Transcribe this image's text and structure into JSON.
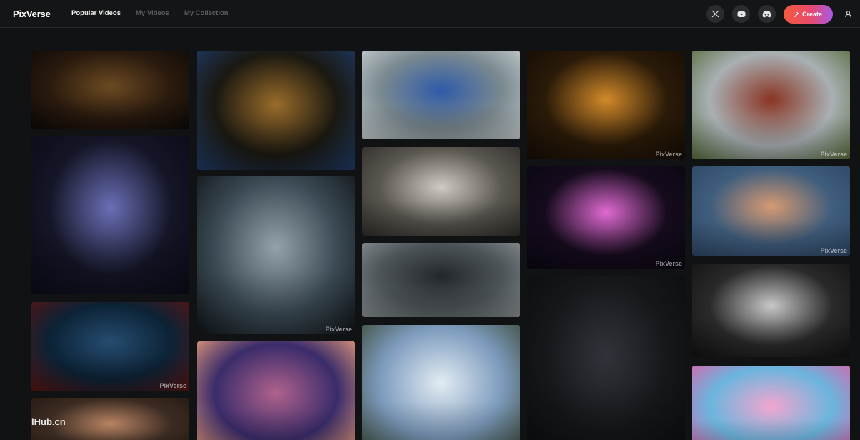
{
  "app": {
    "logo": "PixVerse"
  },
  "nav": {
    "items": [
      {
        "label": "Popular Videos",
        "active": true
      },
      {
        "label": "My Videos",
        "active": false
      },
      {
        "label": "My Collection",
        "active": false
      }
    ]
  },
  "actions": {
    "create_label": "Create",
    "icons": [
      "x-icon",
      "youtube-icon",
      "discord-icon",
      "user-icon"
    ]
  },
  "watermark": "PixVerse",
  "overlay_text": "lHub.cn",
  "cards": [
    {
      "name": "car-night-road",
      "colors": [
        "#2a1a0e",
        "#6b4a22",
        "#0c0907"
      ],
      "watermark": false
    },
    {
      "name": "jellyfish-blue",
      "colors": [
        "#141526",
        "#6a6fb6",
        "#0a0b17"
      ],
      "watermark": false
    },
    {
      "name": "sports-car-neon-city",
      "colors": [
        "#0c2235",
        "#254c70",
        "#581412"
      ],
      "watermark": true
    },
    {
      "name": "woman-portrait",
      "colors": [
        "#3b2b22",
        "#b88463",
        "#241812"
      ],
      "watermark": false
    },
    {
      "name": "fairy-butterfly",
      "colors": [
        "#1a1811",
        "#9a6c2a",
        "#1f3a66"
      ],
      "watermark": false
    },
    {
      "name": "woman-lake-mountains",
      "colors": [
        "#3b4a54",
        "#94a2ab",
        "#101418"
      ],
      "watermark": true
    },
    {
      "name": "purple-sunset-clouds",
      "colors": [
        "#3a2c6a",
        "#b0628c",
        "#f0a27a"
      ],
      "watermark": false
    },
    {
      "name": "bluebird-water",
      "colors": [
        "#7b8a90",
        "#2e5aa8",
        "#c9d0d2"
      ],
      "watermark": false
    },
    {
      "name": "perfume-bottle",
      "colors": [
        "#5a5650",
        "#cfcbc4",
        "#2e2c28"
      ],
      "watermark": false
    },
    {
      "name": "knight-horse-village",
      "colors": [
        "#4d5458",
        "#22272b",
        "#8a9094"
      ],
      "watermark": false
    },
    {
      "name": "snowy-mountains",
      "colors": [
        "#7d9bbd",
        "#e3ecf3",
        "#3c4a38"
      ],
      "watermark": false
    },
    {
      "name": "sunset-lake",
      "colors": [
        "#2a1a08",
        "#d28a2a",
        "#150c06"
      ],
      "watermark": true
    },
    {
      "name": "pink-jellyfish",
      "colors": [
        "#150b1c",
        "#e06ad3",
        "#0a0712"
      ],
      "watermark": true
    },
    {
      "name": "hooded-figure-forest",
      "colors": [
        "#15171a",
        "#30343a",
        "#0b0c0e"
      ],
      "watermark": false
    },
    {
      "name": "train-village",
      "colors": [
        "#a9b0b4",
        "#8a3422",
        "#566a3a"
      ],
      "watermark": true
    },
    {
      "name": "cartoon-girl",
      "colors": [
        "#3f5d7d",
        "#d69a72",
        "#2e4664"
      ],
      "watermark": true
    },
    {
      "name": "noir-couple",
      "colors": [
        "#2a2a2a",
        "#c8c8c8",
        "#111111"
      ],
      "watermark": false
    },
    {
      "name": "pink-dog-beach",
      "colors": [
        "#6ab5dd",
        "#f2a6cf",
        "#e060a8"
      ],
      "watermark": false
    }
  ]
}
